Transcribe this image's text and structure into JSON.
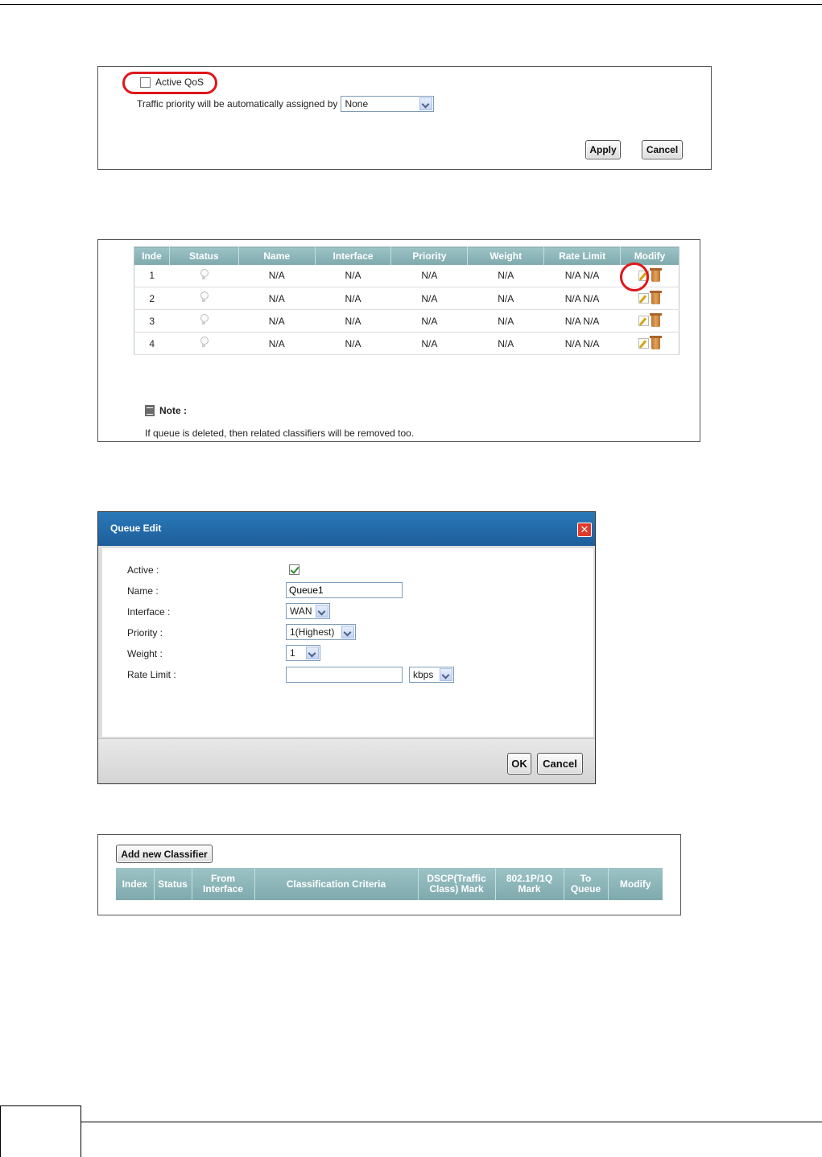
{
  "qos_settings": {
    "active_qos_label": "Active QoS",
    "active_qos_checked": false,
    "traffic_priority_label": "Traffic priority will be automatically assigned by",
    "traffic_priority_value": "None",
    "apply_label": "Apply",
    "cancel_label": "Cancel",
    "highlight_color": "#e0161b"
  },
  "queue_setup": {
    "columns": [
      "Inde",
      "Status",
      "Name",
      "Interface",
      "Priority",
      "Weight",
      "Rate Limit",
      "Modify"
    ],
    "rows": [
      {
        "index": "1",
        "status": "off",
        "name": "N/A",
        "interface": "N/A",
        "priority": "N/A",
        "weight": "N/A",
        "rate_limit": "N/A N/A"
      },
      {
        "index": "2",
        "status": "off",
        "name": "N/A",
        "interface": "N/A",
        "priority": "N/A",
        "weight": "N/A",
        "rate_limit": "N/A N/A"
      },
      {
        "index": "3",
        "status": "off",
        "name": "N/A",
        "interface": "N/A",
        "priority": "N/A",
        "weight": "N/A",
        "rate_limit": "N/A N/A"
      },
      {
        "index": "4",
        "status": "off",
        "name": "N/A",
        "interface": "N/A",
        "priority": "N/A",
        "weight": "N/A",
        "rate_limit": "N/A N/A"
      }
    ],
    "note_label": "Note :",
    "note_text": "If queue is deleted, then related classifiers will be removed too.",
    "icons": {
      "status": "lightbulb-icon",
      "edit": "edit-icon",
      "delete": "trash-icon"
    }
  },
  "queue_edit": {
    "title": "Queue Edit",
    "active_label": "Active :",
    "active_checked": true,
    "name_label": "Name :",
    "name_value": "Queue1",
    "interface_label": "Interface :",
    "interface_value": "WAN",
    "priority_label": "Priority :",
    "priority_value": "1(Highest)",
    "weight_label": "Weight :",
    "weight_value": "1",
    "rate_limit_label": "Rate Limit :",
    "rate_limit_value": "",
    "rate_unit_value": "kbps",
    "ok_label": "OK",
    "cancel_label": "Cancel",
    "title_bar_color": "#1d5e9a"
  },
  "classifier": {
    "add_button_label": "Add new Classifier",
    "columns": [
      "Index",
      "Status",
      "From Interface",
      "Classification Criteria",
      "DSCP(Traffic Class) Mark",
      "802.1P/1Q Mark",
      "To Queue",
      "Modify"
    ],
    "header_color": "#7ea9ad"
  }
}
